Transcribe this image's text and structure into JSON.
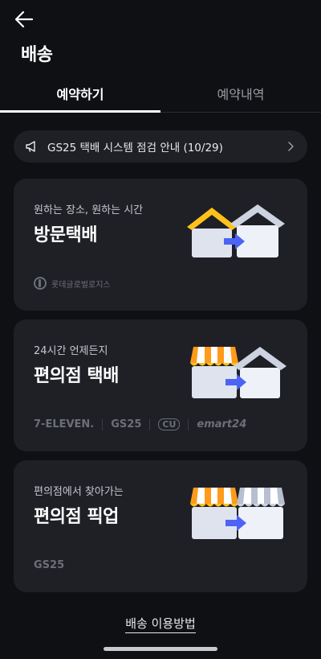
{
  "header": {
    "title": "배송"
  },
  "tabs": [
    {
      "label": "예약하기",
      "active": true
    },
    {
      "label": "예약내역",
      "active": false
    }
  ],
  "notice": {
    "text": "GS25 택배 시스템 점검 안내 (10/29)"
  },
  "cards": [
    {
      "subtitle": "원하는 장소, 원하는 시간",
      "title": "방문택배",
      "brands": [
        "롯데글로벌로지스"
      ]
    },
    {
      "subtitle": "24시간 언제든지",
      "title": "편의점 택배",
      "brands": [
        "7-ELEVEN.",
        "GS25",
        "CU",
        "emart24"
      ]
    },
    {
      "subtitle": "편의점에서 찾아가는",
      "title": "편의점 픽업",
      "brands": [
        "GS25"
      ]
    }
  ],
  "footer": {
    "usage_link": "배송 이용방법"
  },
  "colors": {
    "background": "#0f1014",
    "card": "#1f2026",
    "roof_yellow": "#ffc21a",
    "roof_white": "#e8ecf5",
    "awning_orange": "#ff9a1a",
    "arrow_blue": "#4d63f5"
  }
}
